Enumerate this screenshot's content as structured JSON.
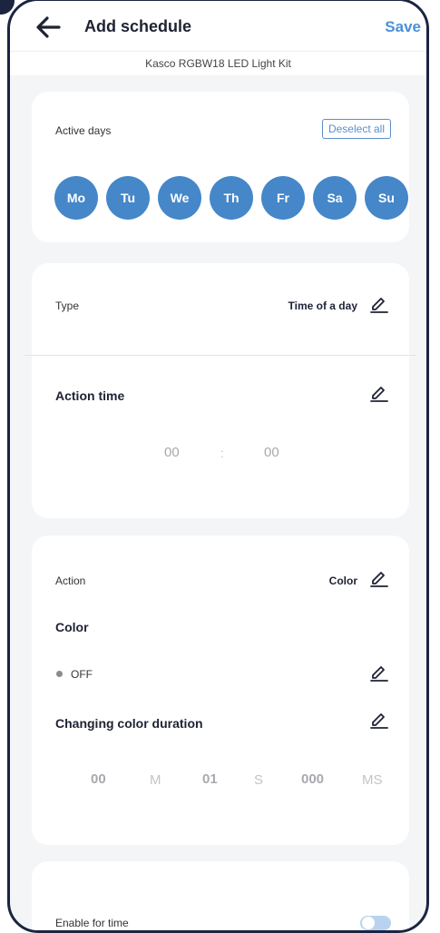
{
  "header": {
    "title": "Add schedule",
    "save_label": "Save",
    "device_name": "Kasco RGBW18 LED Light Kit"
  },
  "active_days": {
    "label": "Active days",
    "deselect_label": "Deselect all",
    "days": [
      "Mo",
      "Tu",
      "We",
      "Th",
      "Fr",
      "Sa",
      "Su"
    ]
  },
  "type_section": {
    "label": "Type",
    "value": "Time of a day",
    "action_time_label": "Action time",
    "hours": "00",
    "separator": ":",
    "minutes": "00"
  },
  "action_section": {
    "label": "Action",
    "value": "Color",
    "color_label": "Color",
    "color_value": "OFF",
    "duration_label": "Changing color duration",
    "minutes": "00",
    "minutes_unit": "M",
    "seconds": "01",
    "seconds_unit": "S",
    "milliseconds": "000",
    "milliseconds_unit": "MS"
  },
  "enable_section": {
    "label": "Enable for time",
    "enabled": false
  },
  "colors": {
    "accent": "#4587c9",
    "save": "#4a8fd8",
    "frame": "#1b2440",
    "background": "#f4f5f7"
  }
}
